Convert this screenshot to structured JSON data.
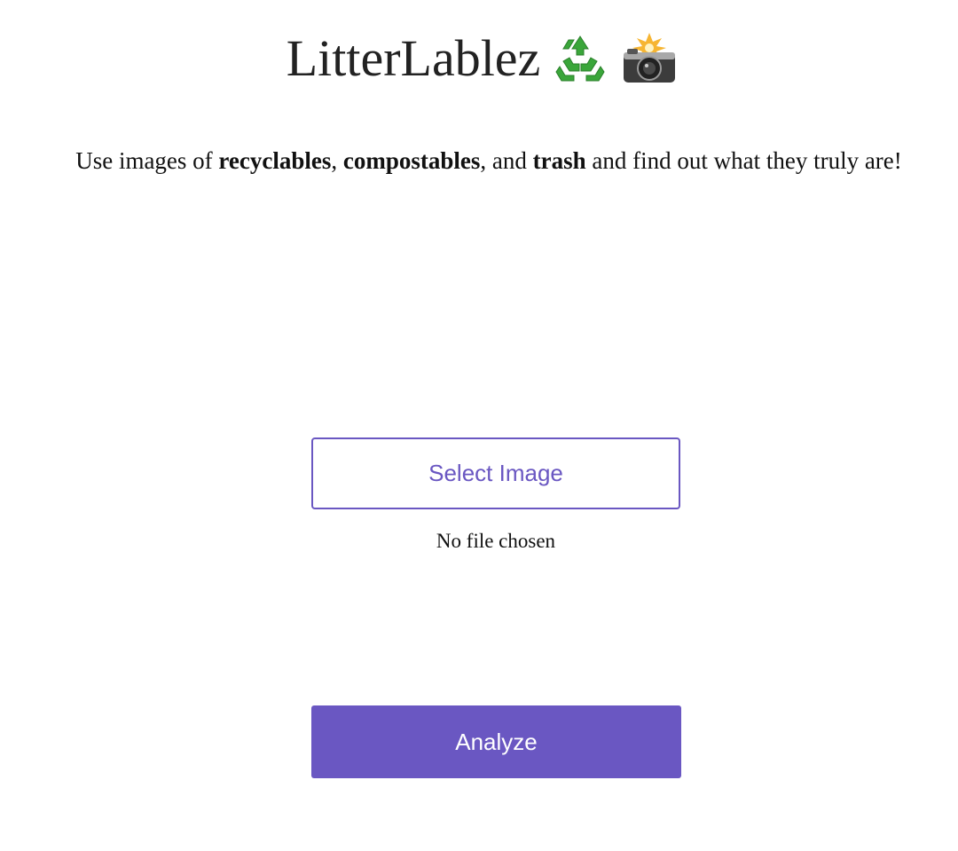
{
  "header": {
    "title": "LitterLablez",
    "icons": [
      "recycle-icon",
      "camera-flash-icon"
    ]
  },
  "tagline": {
    "part1": "Use images of ",
    "bold1": "recyclables",
    "part2": ", ",
    "bold2": "compostables",
    "part3": ", and ",
    "bold3": "trash",
    "part4": " and find out what they truly are!"
  },
  "upload": {
    "select_label": "Select Image",
    "file_status": "No file chosen"
  },
  "actions": {
    "analyze_label": "Analyze"
  },
  "colors": {
    "accent": "#6a57c2",
    "recycle_green": "#3aa63a",
    "text": "#111111",
    "background": "#ffffff"
  }
}
